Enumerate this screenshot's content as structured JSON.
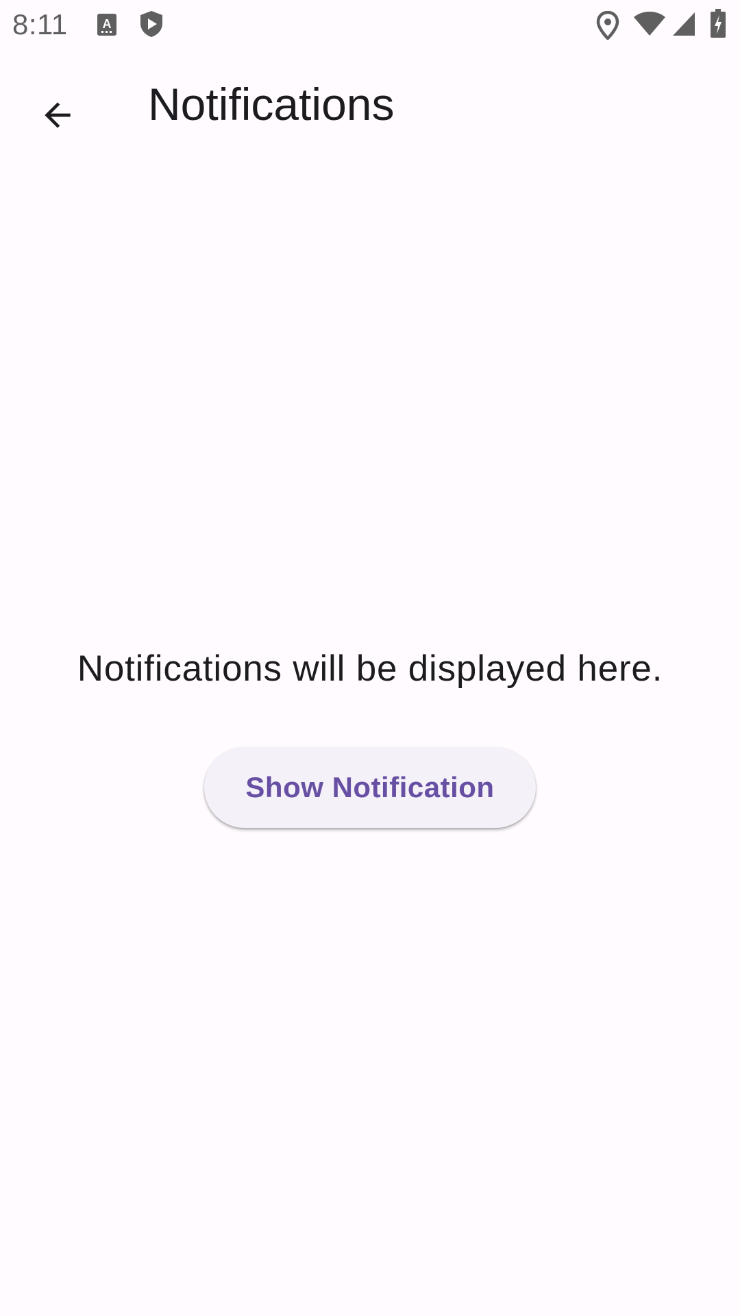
{
  "status_bar": {
    "time": "8:11",
    "left_icons": [
      "text-recognition-icon",
      "shield-play-icon"
    ],
    "right_icons": [
      "location-pin-icon",
      "wifi-icon",
      "cell-signal-icon",
      "battery-charging-icon"
    ]
  },
  "app_bar": {
    "back_icon": "arrow-back-icon",
    "title": "Notifications"
  },
  "main": {
    "empty_message": "Notifications will be displayed here.",
    "button_label": "Show Notification"
  },
  "colors": {
    "background": "#fffbfe",
    "primary": "#6750a4",
    "button_surface": "#f5f1f8",
    "on_surface": "#1c1b1f",
    "status_icons": "#5f5f5f"
  }
}
